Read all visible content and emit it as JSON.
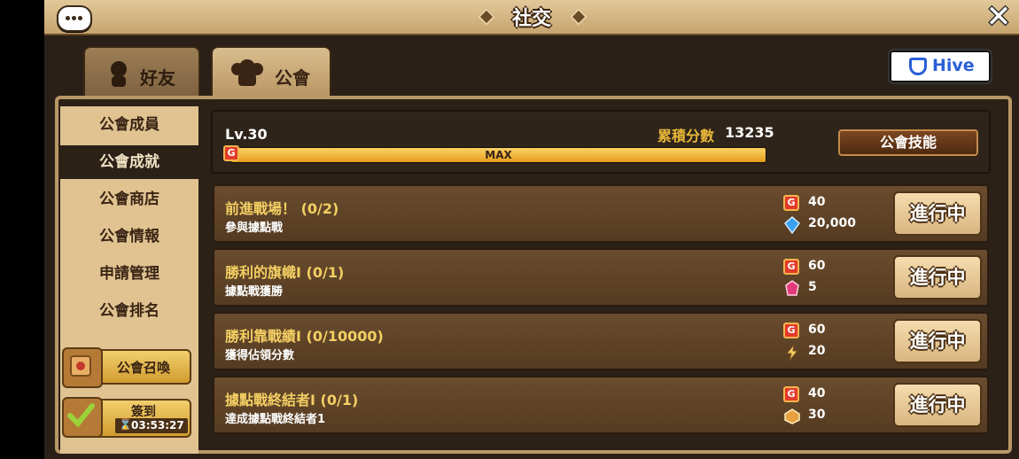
{
  "header": {
    "title": "社交"
  },
  "tabs": [
    {
      "label": "好友"
    },
    {
      "label": "公會"
    }
  ],
  "hive": {
    "label": "Hive"
  },
  "sidebar": {
    "items": [
      {
        "label": "公會成員"
      },
      {
        "label": "公會成就"
      },
      {
        "label": "公會商店"
      },
      {
        "label": "公會情報"
      },
      {
        "label": "申請管理"
      },
      {
        "label": "公會排名"
      }
    ],
    "summon_label": "公會召喚",
    "checkin_label": "簽到",
    "checkin_timer": "03:53:27"
  },
  "guild": {
    "level": "Lv.30",
    "score_label": "累積分數",
    "score_value": "13235",
    "bar_label": "MAX",
    "progress": 1.0,
    "skill_button": "公會技能"
  },
  "missions": [
    {
      "title": "前進戰場！ (0/2)",
      "desc": "參與據點戰",
      "rewards": [
        {
          "icon": "guild-point-icon",
          "value": "40"
        },
        {
          "icon": "blue-crystal-icon",
          "value": "20,000"
        }
      ],
      "button": "進行中"
    },
    {
      "title": "勝利的旗幟I (0/1)",
      "desc": "據點戰獲勝",
      "rewards": [
        {
          "icon": "guild-point-icon",
          "value": "60"
        },
        {
          "icon": "red-crystal-icon",
          "value": "5"
        }
      ],
      "button": "進行中"
    },
    {
      "title": "勝利靠戰績I (0/10000)",
      "desc": "獲得佔領分數",
      "rewards": [
        {
          "icon": "guild-point-icon",
          "value": "60"
        },
        {
          "icon": "energy-icon",
          "value": "20"
        }
      ],
      "button": "進行中"
    },
    {
      "title": "據點戰終結者I (0/1)",
      "desc": "達成據點戰終結者1",
      "rewards": [
        {
          "icon": "guild-point-icon",
          "value": "40"
        },
        {
          "icon": "medal-icon",
          "value": "30"
        }
      ],
      "button": "進行中"
    }
  ],
  "colors": {
    "gold": "#f3cf63",
    "accent_bar": "#e59b1c",
    "hive_blue": "#2a5fd8"
  }
}
